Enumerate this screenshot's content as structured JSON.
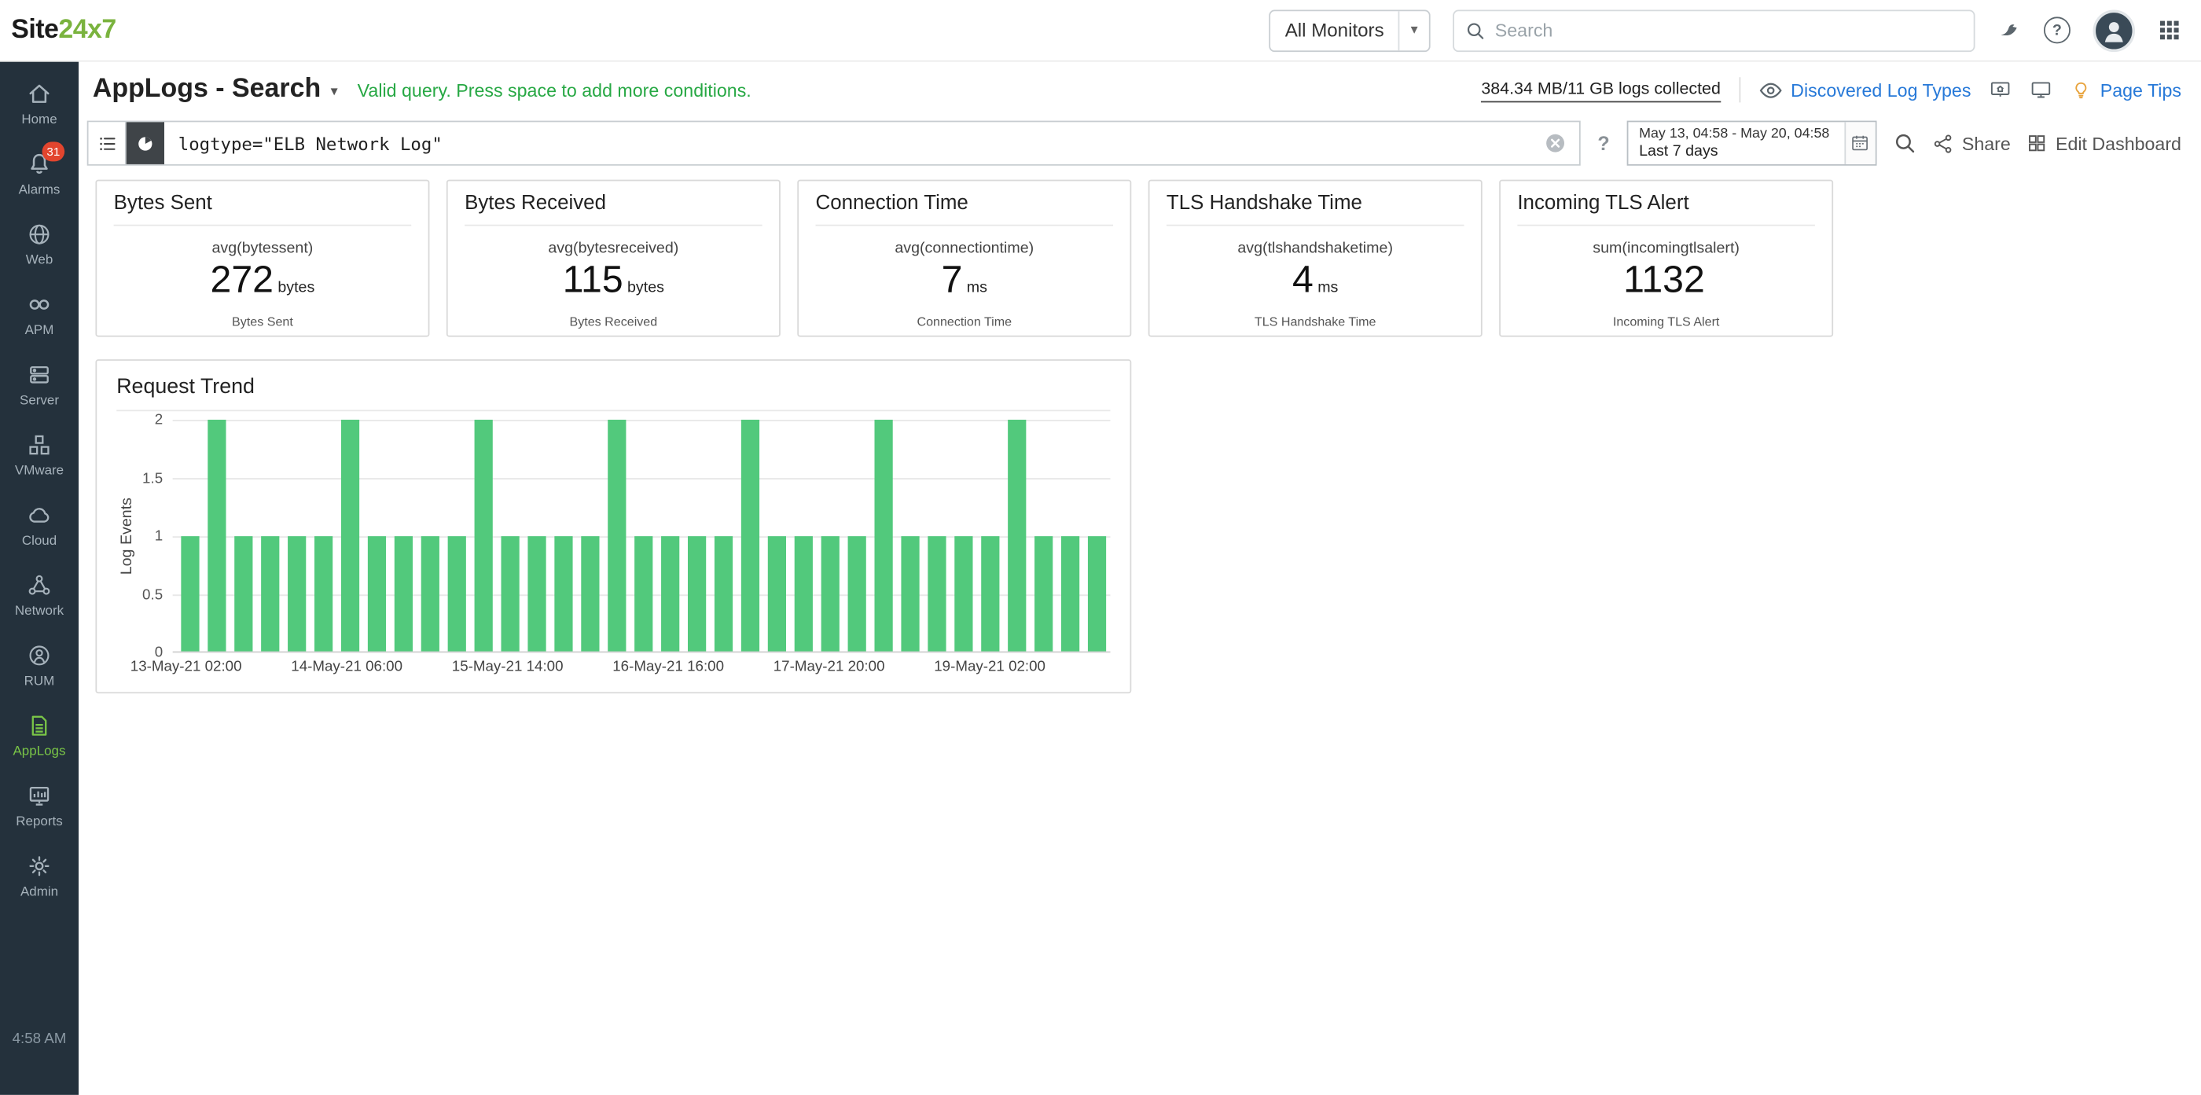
{
  "colors": {
    "brand_green": "#7ab33e",
    "sidebar_bg": "#24313c",
    "sidebar_active_green": "#79c447",
    "alarm_badge_red": "#e2452e",
    "link_blue": "#2779d8",
    "valid_query_green": "#27a844",
    "bar_green": "#52c97c"
  },
  "topbar": {
    "logo_site": "Site",
    "logo_24x7": "24x7",
    "monitors_dropdown": "All Monitors",
    "search_placeholder": "Search",
    "help_glyph": "?"
  },
  "sidebar": {
    "items": [
      {
        "label": "Home"
      },
      {
        "label": "Alarms",
        "badge": "31"
      },
      {
        "label": "Web"
      },
      {
        "label": "APM"
      },
      {
        "label": "Server"
      },
      {
        "label": "VMware"
      },
      {
        "label": "Cloud"
      },
      {
        "label": "Network"
      },
      {
        "label": "RUM"
      },
      {
        "label": "AppLogs"
      },
      {
        "label": "Reports"
      },
      {
        "label": "Admin"
      }
    ],
    "clock": "4:58 AM"
  },
  "header": {
    "title": "AppLogs - Search",
    "valid_query_message": "Valid query. Press space to add more conditions.",
    "usage": "384.34 MB/11 GB logs collected",
    "discovered_log_types_label": "Discovered Log Types",
    "page_tips_label": "Page Tips"
  },
  "toolbar": {
    "query": "logtype=\"ELB Network Log\"",
    "help_glyph": "?",
    "date_range": "May 13, 04:58 - May 20, 04:58",
    "date_preset": "Last 7 days",
    "share_label": "Share",
    "edit_dashboard_label": "Edit Dashboard"
  },
  "stat_cards": [
    {
      "title": "Bytes Sent",
      "aggregation": "avg(bytessent)",
      "value": "272",
      "unit": "bytes",
      "footer": "Bytes Sent"
    },
    {
      "title": "Bytes Received",
      "aggregation": "avg(bytesreceived)",
      "value": "115",
      "unit": "bytes",
      "footer": "Bytes Received"
    },
    {
      "title": "Connection Time",
      "aggregation": "avg(connectiontime)",
      "value": "7",
      "unit": "ms",
      "footer": "Connection Time"
    },
    {
      "title": "TLS Handshake Time",
      "aggregation": "avg(tlshandshaketime)",
      "value": "4",
      "unit": "ms",
      "footer": "TLS Handshake Time"
    },
    {
      "title": "Incoming TLS Alert",
      "aggregation": "sum(incomingtlsalert)",
      "value": "1132",
      "unit": "",
      "footer": "Incoming TLS Alert"
    }
  ],
  "chart_data": {
    "type": "bar",
    "title": "Request Trend",
    "ylabel": "Log Events",
    "xlabel": "",
    "ylim": [
      0,
      2
    ],
    "yticks": [
      "2",
      "1.5",
      "1",
      "0.5",
      "0"
    ],
    "grid": "horizontal",
    "legend": "none",
    "bar_color": "#52c97c",
    "values": [
      1,
      2,
      1,
      1,
      1,
      1,
      2,
      1,
      1,
      1,
      1,
      2,
      1,
      1,
      1,
      1,
      2,
      1,
      1,
      1,
      1,
      2,
      1,
      1,
      1,
      1,
      2,
      1,
      1,
      1,
      1,
      2,
      1,
      1,
      1
    ],
    "x_tick_labels": [
      {
        "label": "13-May-21 02:00",
        "bar_index": 0
      },
      {
        "label": "14-May-21 06:00",
        "bar_index": 6
      },
      {
        "label": "15-May-21 14:00",
        "bar_index": 12
      },
      {
        "label": "16-May-21 16:00",
        "bar_index": 18
      },
      {
        "label": "17-May-21 20:00",
        "bar_index": 24
      },
      {
        "label": "19-May-21 02:00",
        "bar_index": 30
      }
    ]
  }
}
